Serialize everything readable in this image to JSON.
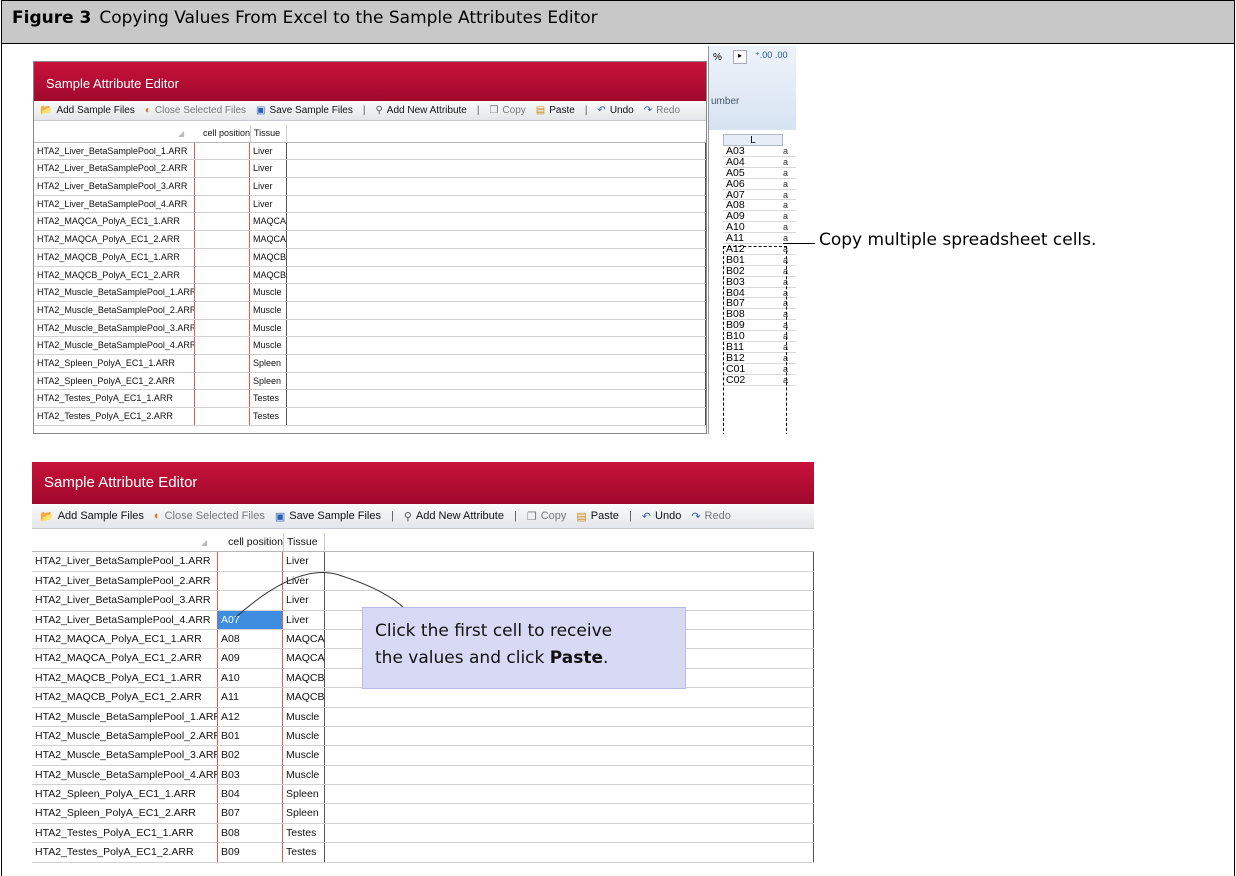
{
  "figure": {
    "number": "Figure 3",
    "caption": "Copying Values From Excel to the Sample Attributes Editor"
  },
  "editor": {
    "title": "Sample Attribute Editor",
    "toolbar": {
      "add_sample_files": "Add Sample Files",
      "close_selected_files": "Close Selected Files",
      "save_sample_files": "Save Sample Files",
      "add_new_attribute": "Add New Attribute",
      "copy": "Copy",
      "paste": "Paste",
      "undo": "Undo",
      "redo": "Redo",
      "separator": "|"
    },
    "columns": {
      "cell_position": "cell position",
      "tissue": "Tissue"
    },
    "files": [
      "HTA2_Liver_BetaSamplePool_1.ARR",
      "HTA2_Liver_BetaSamplePool_2.ARR",
      "HTA2_Liver_BetaSamplePool_3.ARR",
      "HTA2_Liver_BetaSamplePool_4.ARR",
      "HTA2_MAQCA_PolyA_EC1_1.ARR",
      "HTA2_MAQCA_PolyA_EC1_2.ARR",
      "HTA2_MAQCB_PolyA_EC1_1.ARR",
      "HTA2_MAQCB_PolyA_EC1_2.ARR",
      "HTA2_Muscle_BetaSamplePool_1.ARR",
      "HTA2_Muscle_BetaSamplePool_2.ARR",
      "HTA2_Muscle_BetaSamplePool_3.ARR",
      "HTA2_Muscle_BetaSamplePool_4.ARR",
      "HTA2_Spleen_PolyA_EC1_1.ARR",
      "HTA2_Spleen_PolyA_EC1_2.ARR",
      "HTA2_Testes_PolyA_EC1_1.ARR",
      "HTA2_Testes_PolyA_EC1_2.ARR"
    ],
    "tissues": [
      "Liver",
      "Liver",
      "Liver",
      "Liver",
      "MAQCA",
      "MAQCA",
      "MAQCB",
      "MAQCB",
      "Muscle",
      "Muscle",
      "Muscle",
      "Muscle",
      "Spleen",
      "Spleen",
      "Testes",
      "Testes"
    ],
    "pasted_positions": [
      "",
      "",
      "",
      "A07",
      "A08",
      "A09",
      "A10",
      "A11",
      "A12",
      "B01",
      "B02",
      "B03",
      "B04",
      "B07",
      "B08",
      "B09"
    ]
  },
  "excel": {
    "ribbon_format": "%",
    "ribbon_group": "umber",
    "column_header": "L",
    "cells": [
      "A03",
      "A04",
      "A05",
      "A06",
      "A07",
      "A08",
      "A09",
      "A10",
      "A11",
      "A12",
      "B01",
      "B02",
      "B03",
      "B04",
      "B07",
      "B08",
      "B09",
      "B10",
      "B11",
      "B12",
      "C01",
      "C02"
    ]
  },
  "annotations": {
    "copy_note": "Copy multiple spreadsheet cells.",
    "paste_note_line1": "Click the first cell to receive",
    "paste_note_line2": "the values and click ",
    "paste_note_bold": "Paste",
    "paste_note_end": "."
  },
  "colors": {
    "title_bar": "#b80d33",
    "selection": "#3d8ee0",
    "note_bg": "#d8d9f5",
    "header_bg": "#c8c8c8"
  }
}
